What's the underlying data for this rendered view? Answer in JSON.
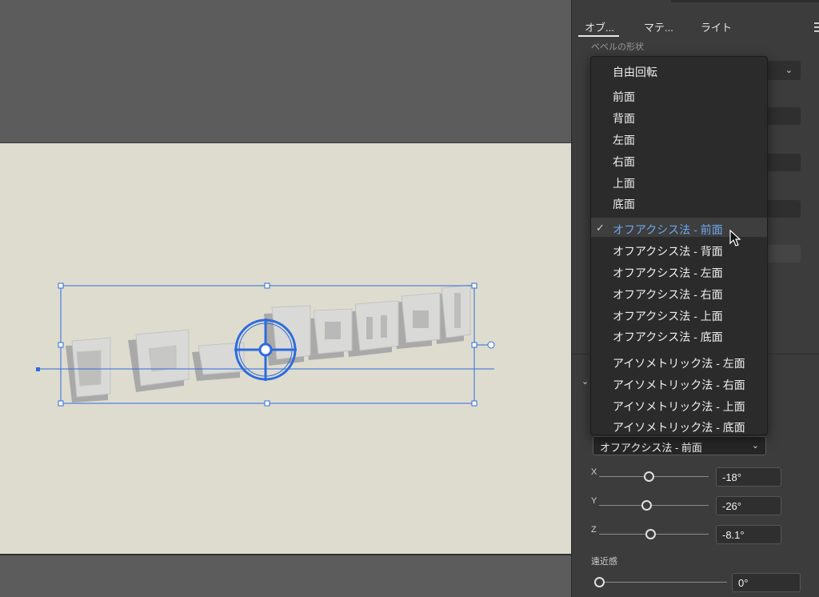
{
  "panel": {
    "tabs": [
      "オブ...",
      "マテ...",
      "ライト"
    ],
    "bevel_label": "ベベルの形状",
    "preset_value": "オフアクシス法 - 前面",
    "rotation": {
      "x": {
        "label": "X",
        "value": "-18°",
        "fraction": 0.45
      },
      "y": {
        "label": "Y",
        "value": "-26°",
        "fraction": 0.43
      },
      "z": {
        "label": "Z",
        "value": "-8.1°",
        "fraction": 0.47
      }
    },
    "perspective": {
      "label": "遠近感",
      "value": "0°",
      "fraction": 0.0
    }
  },
  "dropdown": {
    "items": [
      "自由回転",
      "前面",
      "背面",
      "左面",
      "右面",
      "上面",
      "底面",
      "オフアクシス法 - 前面",
      "オフアクシス法 - 背面",
      "オフアクシス法 - 左面",
      "オフアクシス法 - 右面",
      "オフアクシス法 - 上面",
      "オフアクシス法 - 底面",
      "アイソメトリック法 - 左面",
      "アイソメトリック法 - 右面",
      "アイソメトリック法 - 上面",
      "アイソメトリック法 - 底面"
    ],
    "selected_index": 7,
    "check": "✓"
  },
  "artwork": {
    "text": "ねこきゃわkawaii"
  },
  "colors": {
    "selection": "#2d6bdc",
    "accent_text": "#6ea6ec",
    "artboard": "#dedccf"
  }
}
